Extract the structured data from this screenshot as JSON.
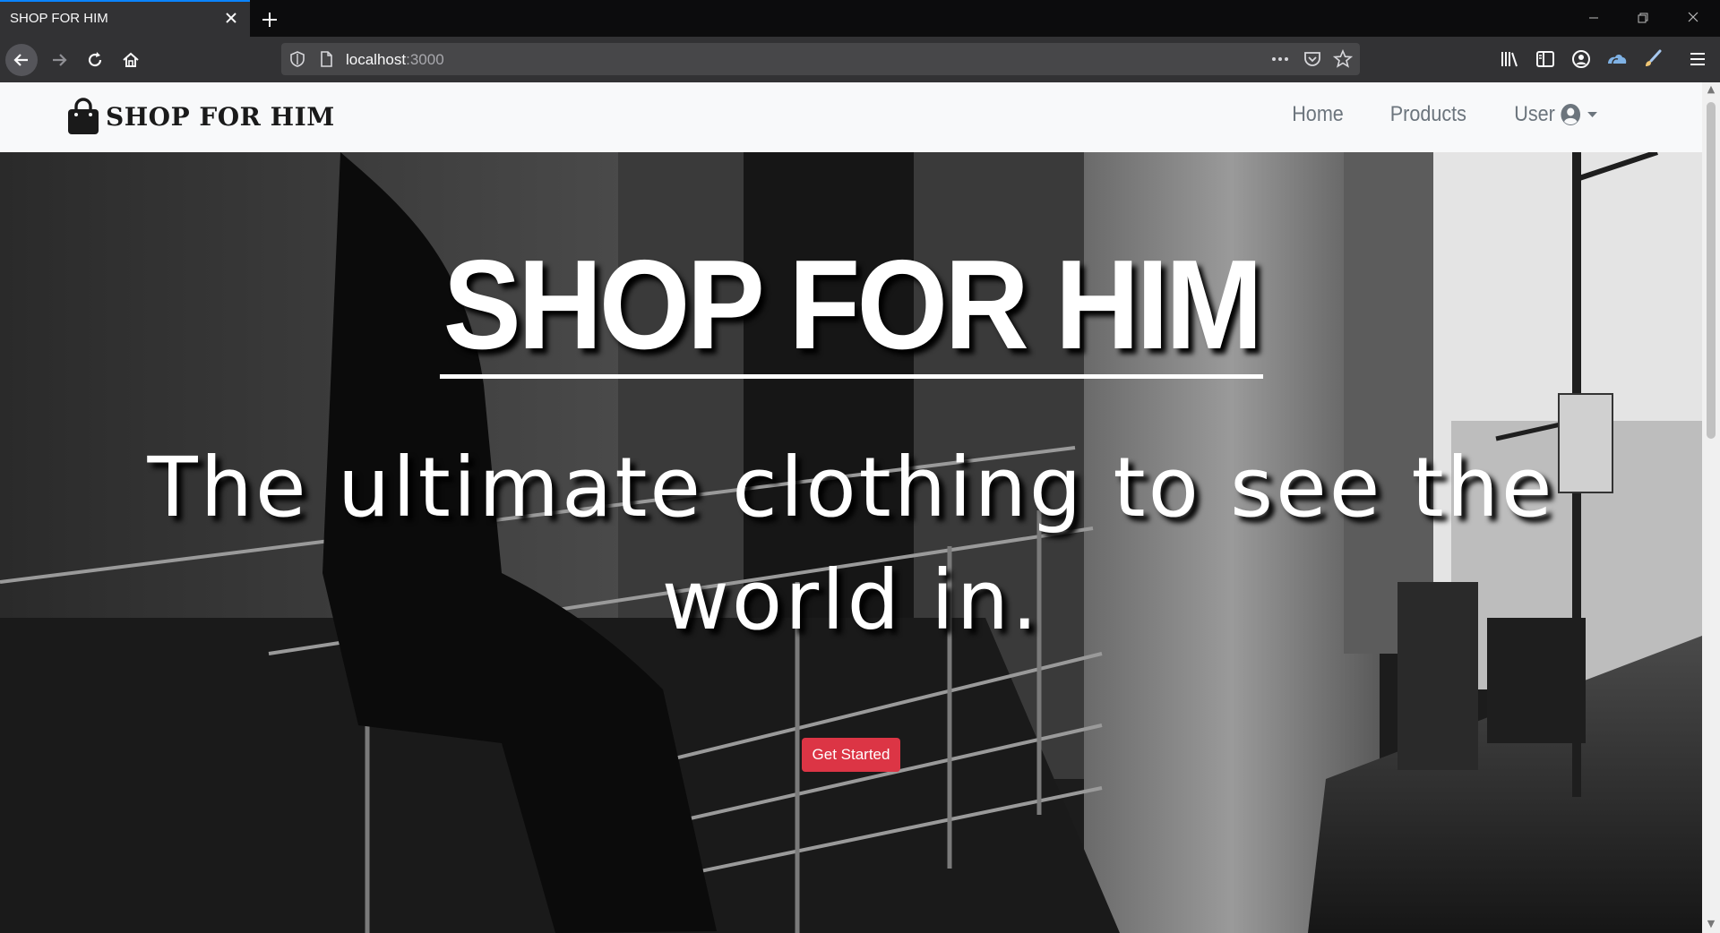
{
  "browser": {
    "tab_title": "SHOP FOR HIM",
    "url_host": "localhost",
    "url_port": ":3000"
  },
  "site": {
    "brand": "SHOP FOR HIM",
    "nav": {
      "home": "Home",
      "products": "Products",
      "user": "User"
    }
  },
  "hero": {
    "title": "SHOP FOR HIM",
    "subtitle": "The ultimate clothing to see the world in.",
    "cta": "Get Started"
  },
  "colors": {
    "cta": "#dc3545",
    "tab_accent": "#0a84ff"
  },
  "icons": [
    "back-arrow-icon",
    "forward-arrow-icon",
    "reload-icon",
    "home-icon",
    "shield-icon",
    "page-icon",
    "more-icon",
    "pocket-icon",
    "star-icon",
    "library-icon",
    "sidebar-icon",
    "account-icon",
    "cloud-icon",
    "paintbrush-icon",
    "hamburger-menu-icon",
    "shopping-bag-icon",
    "user-circle-icon",
    "caret-down-icon"
  ]
}
